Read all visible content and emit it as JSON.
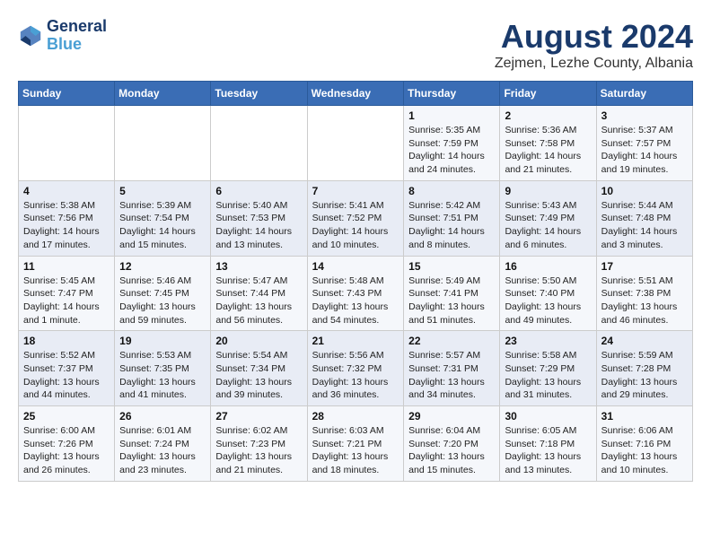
{
  "header": {
    "logo_line1": "General",
    "logo_line2": "Blue",
    "title": "August 2024",
    "subtitle": "Zejmen, Lezhe County, Albania"
  },
  "weekdays": [
    "Sunday",
    "Monday",
    "Tuesday",
    "Wednesday",
    "Thursday",
    "Friday",
    "Saturday"
  ],
  "weeks": [
    [
      {
        "day": "",
        "info": ""
      },
      {
        "day": "",
        "info": ""
      },
      {
        "day": "",
        "info": ""
      },
      {
        "day": "",
        "info": ""
      },
      {
        "day": "1",
        "info": "Sunrise: 5:35 AM\nSunset: 7:59 PM\nDaylight: 14 hours\nand 24 minutes."
      },
      {
        "day": "2",
        "info": "Sunrise: 5:36 AM\nSunset: 7:58 PM\nDaylight: 14 hours\nand 21 minutes."
      },
      {
        "day": "3",
        "info": "Sunrise: 5:37 AM\nSunset: 7:57 PM\nDaylight: 14 hours\nand 19 minutes."
      }
    ],
    [
      {
        "day": "4",
        "info": "Sunrise: 5:38 AM\nSunset: 7:56 PM\nDaylight: 14 hours\nand 17 minutes."
      },
      {
        "day": "5",
        "info": "Sunrise: 5:39 AM\nSunset: 7:54 PM\nDaylight: 14 hours\nand 15 minutes."
      },
      {
        "day": "6",
        "info": "Sunrise: 5:40 AM\nSunset: 7:53 PM\nDaylight: 14 hours\nand 13 minutes."
      },
      {
        "day": "7",
        "info": "Sunrise: 5:41 AM\nSunset: 7:52 PM\nDaylight: 14 hours\nand 10 minutes."
      },
      {
        "day": "8",
        "info": "Sunrise: 5:42 AM\nSunset: 7:51 PM\nDaylight: 14 hours\nand 8 minutes."
      },
      {
        "day": "9",
        "info": "Sunrise: 5:43 AM\nSunset: 7:49 PM\nDaylight: 14 hours\nand 6 minutes."
      },
      {
        "day": "10",
        "info": "Sunrise: 5:44 AM\nSunset: 7:48 PM\nDaylight: 14 hours\nand 3 minutes."
      }
    ],
    [
      {
        "day": "11",
        "info": "Sunrise: 5:45 AM\nSunset: 7:47 PM\nDaylight: 14 hours\nand 1 minute."
      },
      {
        "day": "12",
        "info": "Sunrise: 5:46 AM\nSunset: 7:45 PM\nDaylight: 13 hours\nand 59 minutes."
      },
      {
        "day": "13",
        "info": "Sunrise: 5:47 AM\nSunset: 7:44 PM\nDaylight: 13 hours\nand 56 minutes."
      },
      {
        "day": "14",
        "info": "Sunrise: 5:48 AM\nSunset: 7:43 PM\nDaylight: 13 hours\nand 54 minutes."
      },
      {
        "day": "15",
        "info": "Sunrise: 5:49 AM\nSunset: 7:41 PM\nDaylight: 13 hours\nand 51 minutes."
      },
      {
        "day": "16",
        "info": "Sunrise: 5:50 AM\nSunset: 7:40 PM\nDaylight: 13 hours\nand 49 minutes."
      },
      {
        "day": "17",
        "info": "Sunrise: 5:51 AM\nSunset: 7:38 PM\nDaylight: 13 hours\nand 46 minutes."
      }
    ],
    [
      {
        "day": "18",
        "info": "Sunrise: 5:52 AM\nSunset: 7:37 PM\nDaylight: 13 hours\nand 44 minutes."
      },
      {
        "day": "19",
        "info": "Sunrise: 5:53 AM\nSunset: 7:35 PM\nDaylight: 13 hours\nand 41 minutes."
      },
      {
        "day": "20",
        "info": "Sunrise: 5:54 AM\nSunset: 7:34 PM\nDaylight: 13 hours\nand 39 minutes."
      },
      {
        "day": "21",
        "info": "Sunrise: 5:56 AM\nSunset: 7:32 PM\nDaylight: 13 hours\nand 36 minutes."
      },
      {
        "day": "22",
        "info": "Sunrise: 5:57 AM\nSunset: 7:31 PM\nDaylight: 13 hours\nand 34 minutes."
      },
      {
        "day": "23",
        "info": "Sunrise: 5:58 AM\nSunset: 7:29 PM\nDaylight: 13 hours\nand 31 minutes."
      },
      {
        "day": "24",
        "info": "Sunrise: 5:59 AM\nSunset: 7:28 PM\nDaylight: 13 hours\nand 29 minutes."
      }
    ],
    [
      {
        "day": "25",
        "info": "Sunrise: 6:00 AM\nSunset: 7:26 PM\nDaylight: 13 hours\nand 26 minutes."
      },
      {
        "day": "26",
        "info": "Sunrise: 6:01 AM\nSunset: 7:24 PM\nDaylight: 13 hours\nand 23 minutes."
      },
      {
        "day": "27",
        "info": "Sunrise: 6:02 AM\nSunset: 7:23 PM\nDaylight: 13 hours\nand 21 minutes."
      },
      {
        "day": "28",
        "info": "Sunrise: 6:03 AM\nSunset: 7:21 PM\nDaylight: 13 hours\nand 18 minutes."
      },
      {
        "day": "29",
        "info": "Sunrise: 6:04 AM\nSunset: 7:20 PM\nDaylight: 13 hours\nand 15 minutes."
      },
      {
        "day": "30",
        "info": "Sunrise: 6:05 AM\nSunset: 7:18 PM\nDaylight: 13 hours\nand 13 minutes."
      },
      {
        "day": "31",
        "info": "Sunrise: 6:06 AM\nSunset: 7:16 PM\nDaylight: 13 hours\nand 10 minutes."
      }
    ]
  ]
}
